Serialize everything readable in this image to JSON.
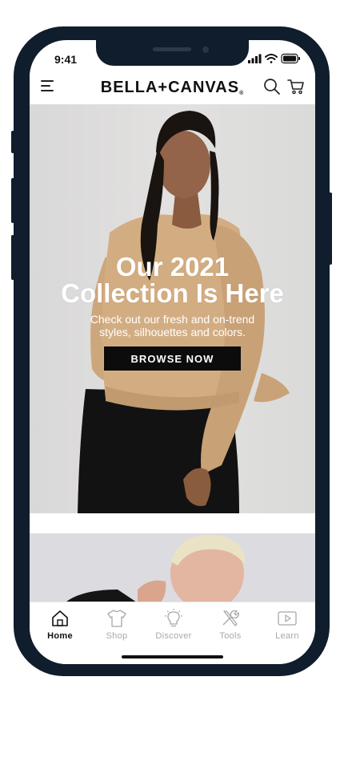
{
  "status_bar": {
    "time": "9:41"
  },
  "header": {
    "menu_icon": "hamburger-menu-icon",
    "logo_text": "BELLA+CANVAS",
    "logo_registered": "®",
    "search_icon": "search-icon",
    "cart_icon": "shopping-cart-icon"
  },
  "hero": {
    "title_line1": "Our 2021",
    "title_line2": "Collection Is Here",
    "subtitle_line1": "Check out our fresh and on-trend",
    "subtitle_line2": "styles, silhouettes and colors.",
    "cta_label": "BROWSE NOW"
  },
  "bottom_nav": {
    "items": [
      {
        "label": "Home",
        "icon": "home-icon",
        "active": true
      },
      {
        "label": "Shop",
        "icon": "tshirt-icon",
        "active": false
      },
      {
        "label": "Discover",
        "icon": "lightbulb-icon",
        "active": false
      },
      {
        "label": "Tools",
        "icon": "tools-icon",
        "active": false
      },
      {
        "label": "Learn",
        "icon": "play-video-icon",
        "active": false
      }
    ]
  },
  "colors": {
    "phone_frame": "#0f1d2c",
    "cta_background": "#0c0c0c",
    "active_nav": "#111111",
    "inactive_nav": "#a8a8a8",
    "sweater": "#d3ad82"
  }
}
